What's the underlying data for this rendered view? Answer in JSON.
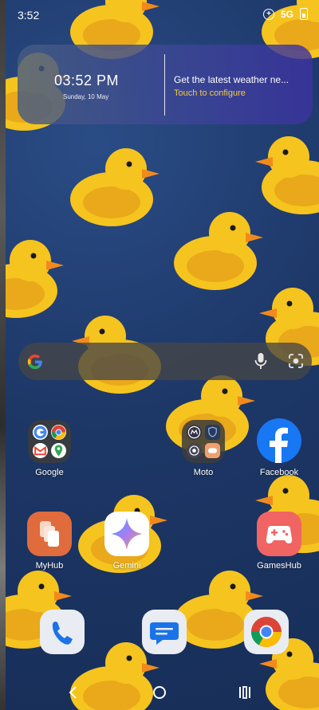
{
  "status_bar": {
    "time": "3:52",
    "network": "5G"
  },
  "widget": {
    "clock": "03:52 PM",
    "date": "Sunday, 10 May",
    "weather_prompt": "Get the latest weather ne...",
    "configure_label": "Touch to configure",
    "configure_color": "#f2c94c"
  },
  "search": {
    "icons": [
      "google-g-icon",
      "mic-icon",
      "lens-icon"
    ]
  },
  "apps": [
    {
      "label": "Google",
      "type": "folder"
    },
    {
      "label": "Moto",
      "type": "folder"
    },
    {
      "label": "Facebook",
      "type": "app",
      "color": "#1877f2"
    },
    {
      "label": "MyHub",
      "type": "app",
      "color": "#e06b3c"
    },
    {
      "label": "Gemini",
      "type": "app",
      "color": "#ffffff"
    },
    {
      "label": "GamesHub",
      "type": "app",
      "color": "#f06464"
    }
  ],
  "dock": [
    "phone-icon",
    "messages-icon",
    "chrome-icon"
  ],
  "nav": [
    "back-icon",
    "home-icon",
    "recents-icon"
  ]
}
